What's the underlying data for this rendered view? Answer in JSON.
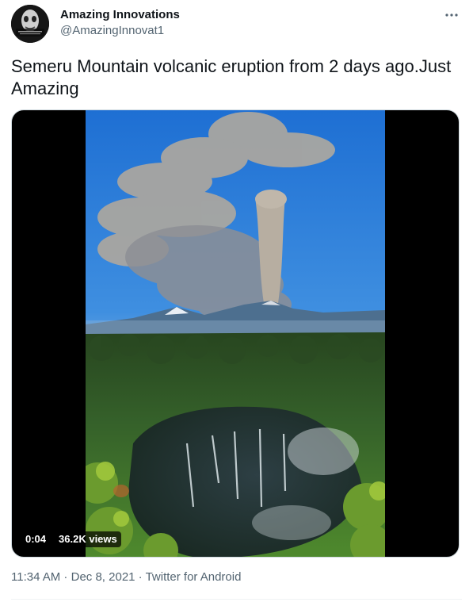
{
  "author": {
    "display_name": "Amazing Innovations",
    "handle": "@AmazingInnovat1"
  },
  "tweet": {
    "text": "Semeru Mountain volcanic eruption from 2 days ago.Just Amazing"
  },
  "video": {
    "elapsed": "0:04",
    "views": "36.2K views"
  },
  "meta": {
    "time": "11:34 AM",
    "separator_1": " · ",
    "date": "Dec 8, 2021",
    "separator_2": " · ",
    "source": "Twitter for Android"
  },
  "icons": {
    "more": "more-horizontal-icon",
    "avatar": "profile-avatar"
  },
  "colors": {
    "text_primary": "#0f1419",
    "text_secondary": "#536471",
    "media_border": "#cfd9de",
    "divider": "#eff3f4"
  }
}
